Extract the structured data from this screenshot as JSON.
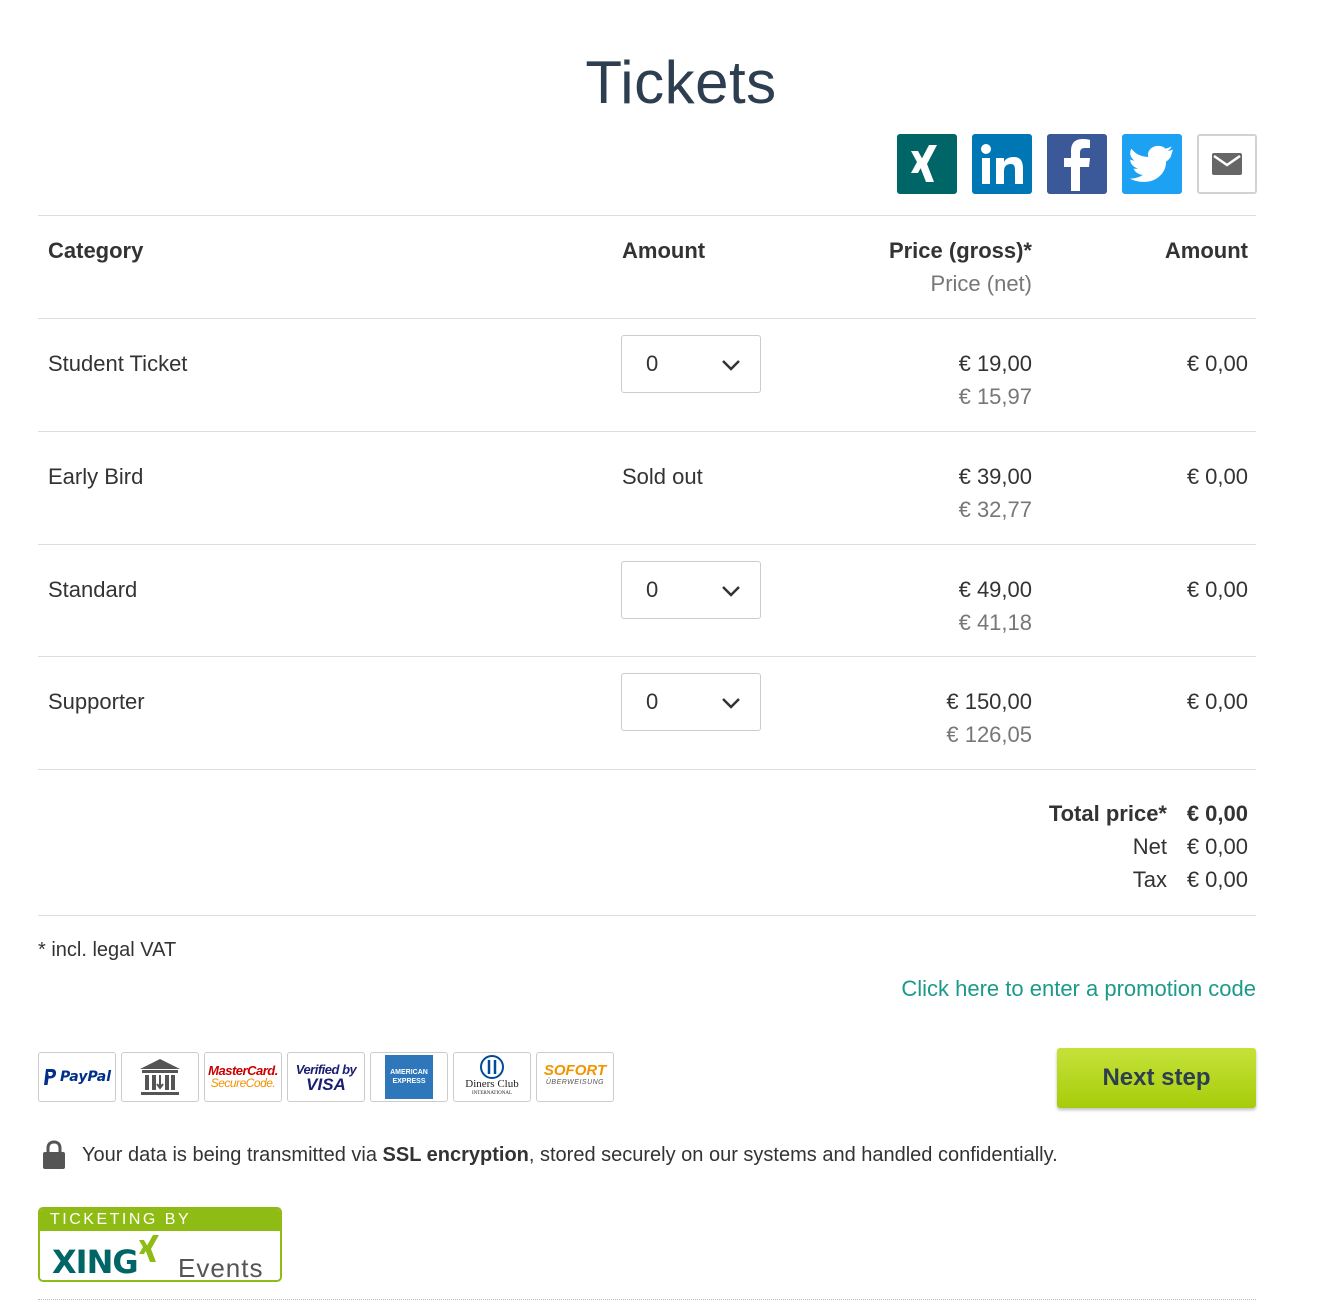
{
  "page": {
    "title": "Tickets"
  },
  "share": [
    "xing-icon",
    "linkedin-icon",
    "facebook-icon",
    "twitter-icon",
    "email-icon"
  ],
  "table": {
    "headers": {
      "category": "Category",
      "amount": "Amount",
      "price_gross": "Price (gross)*",
      "price_net": "Price (net)",
      "total": "Amount"
    },
    "rows": [
      {
        "category": "Student Ticket",
        "quantity": "0",
        "status": "",
        "gross": "€ 19,00",
        "net": "€ 15,97",
        "amount": "€ 0,00"
      },
      {
        "category": "Early Bird",
        "quantity": "",
        "status": "Sold out",
        "gross": "€ 39,00",
        "net": "€ 32,77",
        "amount": "€ 0,00"
      },
      {
        "category": "Standard",
        "quantity": "0",
        "status": "",
        "gross": "€ 49,00",
        "net": "€ 41,18",
        "amount": "€ 0,00"
      },
      {
        "category": "Supporter",
        "quantity": "0",
        "status": "",
        "gross": "€ 150,00",
        "net": "€ 126,05",
        "amount": "€ 0,00"
      }
    ]
  },
  "totals": {
    "total_label": "Total price*",
    "total_value": "€ 0,00",
    "net_label": "Net",
    "net_value": "€ 0,00",
    "tax_label": "Tax",
    "tax_value": "€ 0,00"
  },
  "vat_note": "* incl. legal VAT",
  "promo_link": "Click here to enter a promotion code",
  "payment": {
    "paypal": "PayPal",
    "mastercard_line1": "MasterCard.",
    "mastercard_line2": "SecureCode.",
    "visa_line1": "Verified by",
    "visa_line2": "VISA",
    "amex_line1": "AMERICAN",
    "amex_line2": "EXPRESS",
    "diners_line1": "Diners Club",
    "diners_line2": "INTERNATIONAL",
    "sofort_line1": "SOFORT",
    "sofort_line2": "ÜBERWEISUNG"
  },
  "next_button": "Next step",
  "ssl": {
    "prefix": "Your data is being transmitted via ",
    "bold": "SSL encryption",
    "suffix": ", stored securely on our systems and handled confidentially."
  },
  "badge": {
    "top": "TICKETING BY",
    "brand": "XING",
    "events": "Events"
  },
  "colors": {
    "accent": "#1b9a8a",
    "button": "#a7cc0a",
    "title": "#2c3e50",
    "xing": "#006567"
  }
}
